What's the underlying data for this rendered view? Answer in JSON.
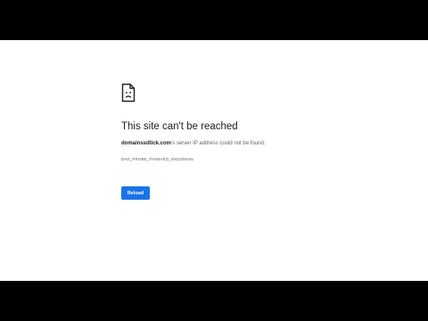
{
  "error": {
    "icon": "sad-document-icon",
    "title": "This site can't be reached",
    "domain": "domainssdtick.com",
    "message_suffix": "'s server IP address could not be found.",
    "code": "DNS_PROBE_FINISHED_NXDOMAIN"
  },
  "actions": {
    "reload_label": "Reload"
  },
  "colors": {
    "accent": "#1a73e8",
    "letterbox": "#000000",
    "page_background": "#ffffff",
    "title_text": "#202124",
    "secondary_text": "#5f6368"
  }
}
